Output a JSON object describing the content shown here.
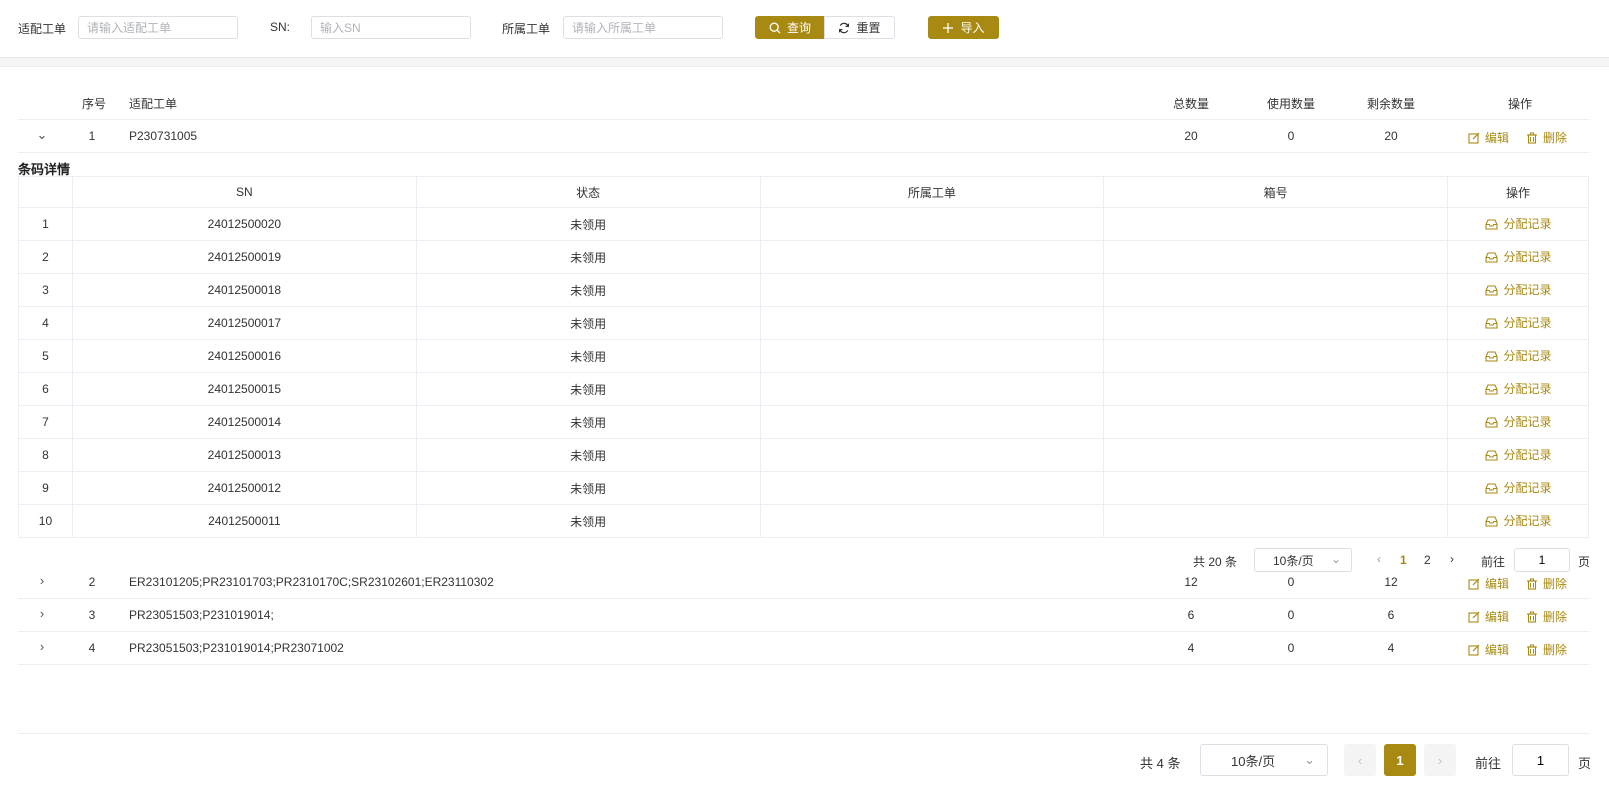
{
  "filters": {
    "order_label": "适配工单",
    "order_placeholder": "请输入适配工单",
    "sn_label": "SN:",
    "sn_placeholder": "输入SN",
    "belong_label": "所属工单",
    "belong_placeholder": "请输入所属工单",
    "query_label": "查询",
    "reset_label": "重置",
    "import_label": "导入"
  },
  "main_table": {
    "headers": {
      "index": "序号",
      "order": "适配工单",
      "total": "总数量",
      "used": "使用数量",
      "remain": "剩余数量",
      "ops": "操作"
    },
    "edit_label": "编辑",
    "delete_label": "删除",
    "rows": [
      {
        "index": "1",
        "order": "P230731005",
        "total": "20",
        "used": "0",
        "remain": "20",
        "expanded": true
      },
      {
        "index": "2",
        "order": "ER23101205;PR23101703;PR2310170C;SR23102601;ER23110302",
        "total": "12",
        "used": "0",
        "remain": "12",
        "expanded": false
      },
      {
        "index": "3",
        "order": "PR23051503;P231019014;",
        "total": "6",
        "used": "0",
        "remain": "6",
        "expanded": false
      },
      {
        "index": "4",
        "order": "PR23051503;P231019014;PR23071002",
        "total": "4",
        "used": "0",
        "remain": "4",
        "expanded": false
      }
    ]
  },
  "detail": {
    "title": "条码详情",
    "headers": {
      "sn": "SN",
      "status": "状态",
      "belong": "所属工单",
      "box": "箱号",
      "ops": "操作"
    },
    "alloc_label": "分配记录",
    "rows": [
      {
        "no": "1",
        "sn": "24012500020",
        "status": "未领用",
        "belong": "",
        "box": ""
      },
      {
        "no": "2",
        "sn": "24012500019",
        "status": "未领用",
        "belong": "",
        "box": ""
      },
      {
        "no": "3",
        "sn": "24012500018",
        "status": "未领用",
        "belong": "",
        "box": ""
      },
      {
        "no": "4",
        "sn": "24012500017",
        "status": "未领用",
        "belong": "",
        "box": ""
      },
      {
        "no": "5",
        "sn": "24012500016",
        "status": "未领用",
        "belong": "",
        "box": ""
      },
      {
        "no": "6",
        "sn": "24012500015",
        "status": "未领用",
        "belong": "",
        "box": ""
      },
      {
        "no": "7",
        "sn": "24012500014",
        "status": "未领用",
        "belong": "",
        "box": ""
      },
      {
        "no": "8",
        "sn": "24012500013",
        "status": "未领用",
        "belong": "",
        "box": ""
      },
      {
        "no": "9",
        "sn": "24012500012",
        "status": "未领用",
        "belong": "",
        "box": ""
      },
      {
        "no": "10",
        "sn": "24012500011",
        "status": "未领用",
        "belong": "",
        "box": ""
      }
    ],
    "pagination": {
      "total_text": "共 20 条",
      "page_size": "10条/页",
      "pages": [
        "1",
        "2"
      ],
      "current": "1",
      "goto_label": "前往",
      "goto_value": "1",
      "page_suffix": "页"
    }
  },
  "pagination": {
    "total_text": "共 4 条",
    "page_size": "10条/页",
    "current": "1",
    "goto_label": "前往",
    "goto_value": "1",
    "page_suffix": "页"
  },
  "colors": {
    "accent": "#a88a12",
    "border": "#ebeef5"
  }
}
